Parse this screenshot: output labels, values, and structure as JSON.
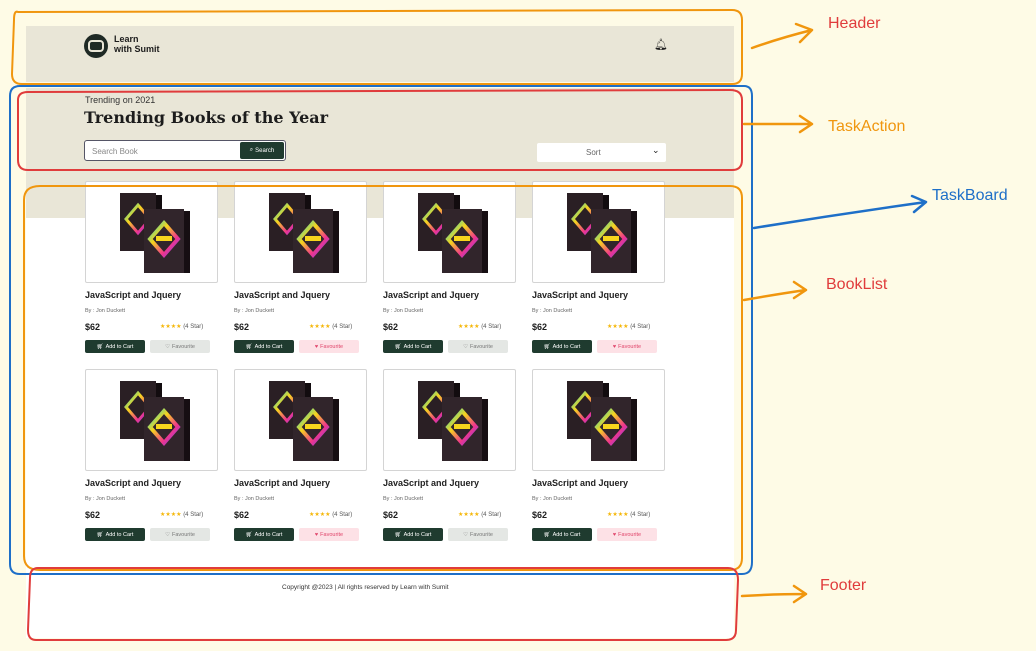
{
  "site": {
    "logo_text": "Learn\nwith Sumit",
    "bell_icon": "bell-icon",
    "trend_subtitle": "Trending on 2021",
    "trend_title": "Trending Books of the Year",
    "search_placeholder": "Search Book",
    "search_button": "Search",
    "sort_label": "Sort",
    "footer_text": "Copyright @2023 | All rights reserved by Learn with Sumit"
  },
  "books": [
    {
      "title": "JavaScript and Jquery",
      "author": "By : Jon Duckett",
      "price": "$62",
      "rating": 4,
      "rating_label": "(4 Star)",
      "cart_label": "Add to Cart",
      "fav_label": "Favourite",
      "favourited": false
    },
    {
      "title": "JavaScript and Jquery",
      "author": "By : Jon Duckett",
      "price": "$62",
      "rating": 4,
      "rating_label": "(4 Star)",
      "cart_label": "Add to Cart",
      "fav_label": "Favourite",
      "favourited": true
    },
    {
      "title": "JavaScript and Jquery",
      "author": "By : Jon Duckett",
      "price": "$62",
      "rating": 4,
      "rating_label": "(4 Star)",
      "cart_label": "Add to Cart",
      "fav_label": "Favourite",
      "favourited": false
    },
    {
      "title": "JavaScript and Jquery",
      "author": "By : Jon Duckett",
      "price": "$62",
      "rating": 4,
      "rating_label": "(4 Star)",
      "cart_label": "Add to Cart",
      "fav_label": "Favourite",
      "favourited": true
    },
    {
      "title": "JavaScript and Jquery",
      "author": "By : Jon Duckett",
      "price": "$62",
      "rating": 4,
      "rating_label": "(4 Star)",
      "cart_label": "Add to Cart",
      "fav_label": "Favourite",
      "favourited": false
    },
    {
      "title": "JavaScript and Jquery",
      "author": "By : Jon Duckett",
      "price": "$62",
      "rating": 4,
      "rating_label": "(4 Star)",
      "cart_label": "Add to Cart",
      "fav_label": "Favourite",
      "favourited": true
    },
    {
      "title": "JavaScript and Jquery",
      "author": "By : Jon Duckett",
      "price": "$62",
      "rating": 4,
      "rating_label": "(4 Star)",
      "cart_label": "Add to Cart",
      "fav_label": "Favourite",
      "favourited": false
    },
    {
      "title": "JavaScript and Jquery",
      "author": "By : Jon Duckett",
      "price": "$62",
      "rating": 4,
      "rating_label": "(4 Star)",
      "cart_label": "Add to Cart",
      "fav_label": "Favourite",
      "favourited": true
    }
  ],
  "annotations": [
    {
      "label": "Header",
      "color": "#e03c3c"
    },
    {
      "label": "TaskAction",
      "color": "#f0960e"
    },
    {
      "label": "TaskBoard",
      "color": "#1e6fc8"
    },
    {
      "label": "BookList",
      "color": "#e03c3c"
    },
    {
      "label": "Footer",
      "color": "#e03c3c"
    }
  ]
}
